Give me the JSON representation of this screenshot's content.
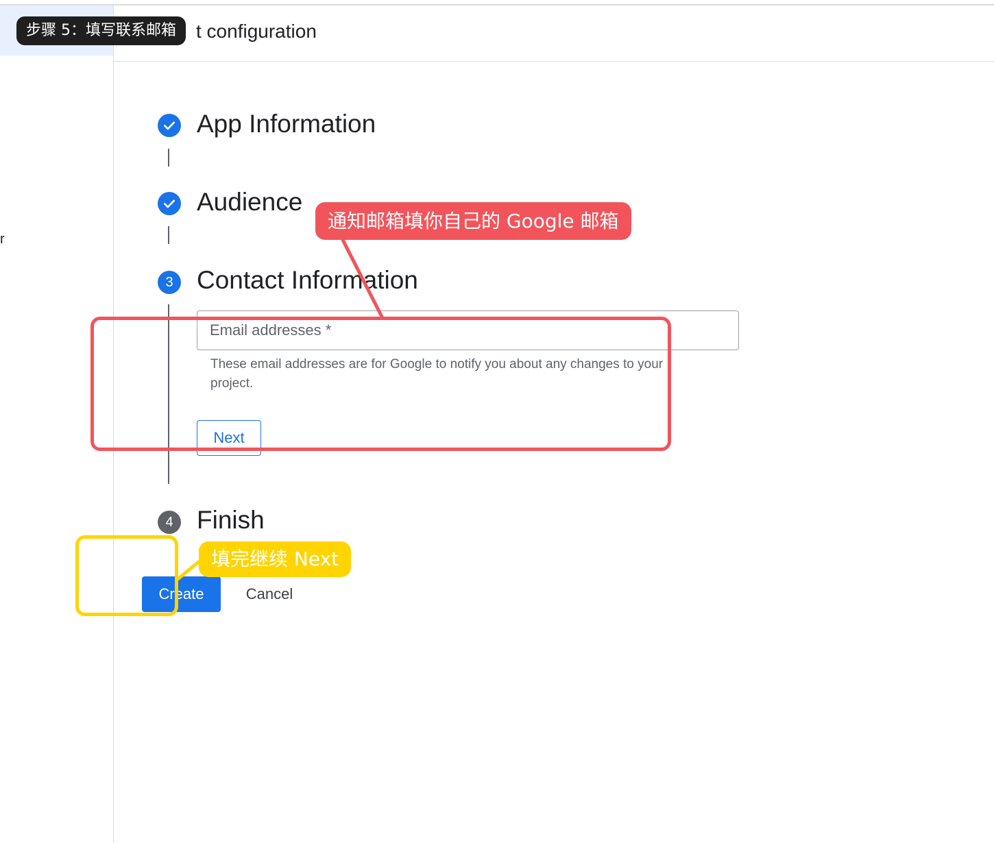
{
  "header": {
    "title": "t configuration",
    "sidebar_fragment": "r"
  },
  "stepper": {
    "steps": [
      {
        "label": "App Information",
        "status": "completed",
        "number": ""
      },
      {
        "label": "Audience",
        "status": "completed",
        "number": ""
      },
      {
        "label": "Contact Information",
        "status": "current",
        "number": "3"
      },
      {
        "label": "Finish",
        "status": "pending",
        "number": "4"
      }
    ]
  },
  "contact_form": {
    "email_placeholder": "Email addresses *",
    "email_value": "",
    "helper_text": "These email addresses are for Google to notify you about any changes to your project.",
    "next_label": "Next"
  },
  "actions": {
    "create_label": "Create",
    "cancel_label": "Cancel"
  },
  "annotations": {
    "step_badge": "步骤 5：填写联系邮箱",
    "red_callout": "通知邮箱填你自己的 Google 邮箱",
    "yellow_callout": "填完继续 Next",
    "colors": {
      "red": "#f2545b",
      "yellow": "#ffd400",
      "badge": "#1f1f1f"
    }
  },
  "colors": {
    "accent": "#1a73e8",
    "pending_step": "#5f6368",
    "divider": "#dadce0"
  }
}
